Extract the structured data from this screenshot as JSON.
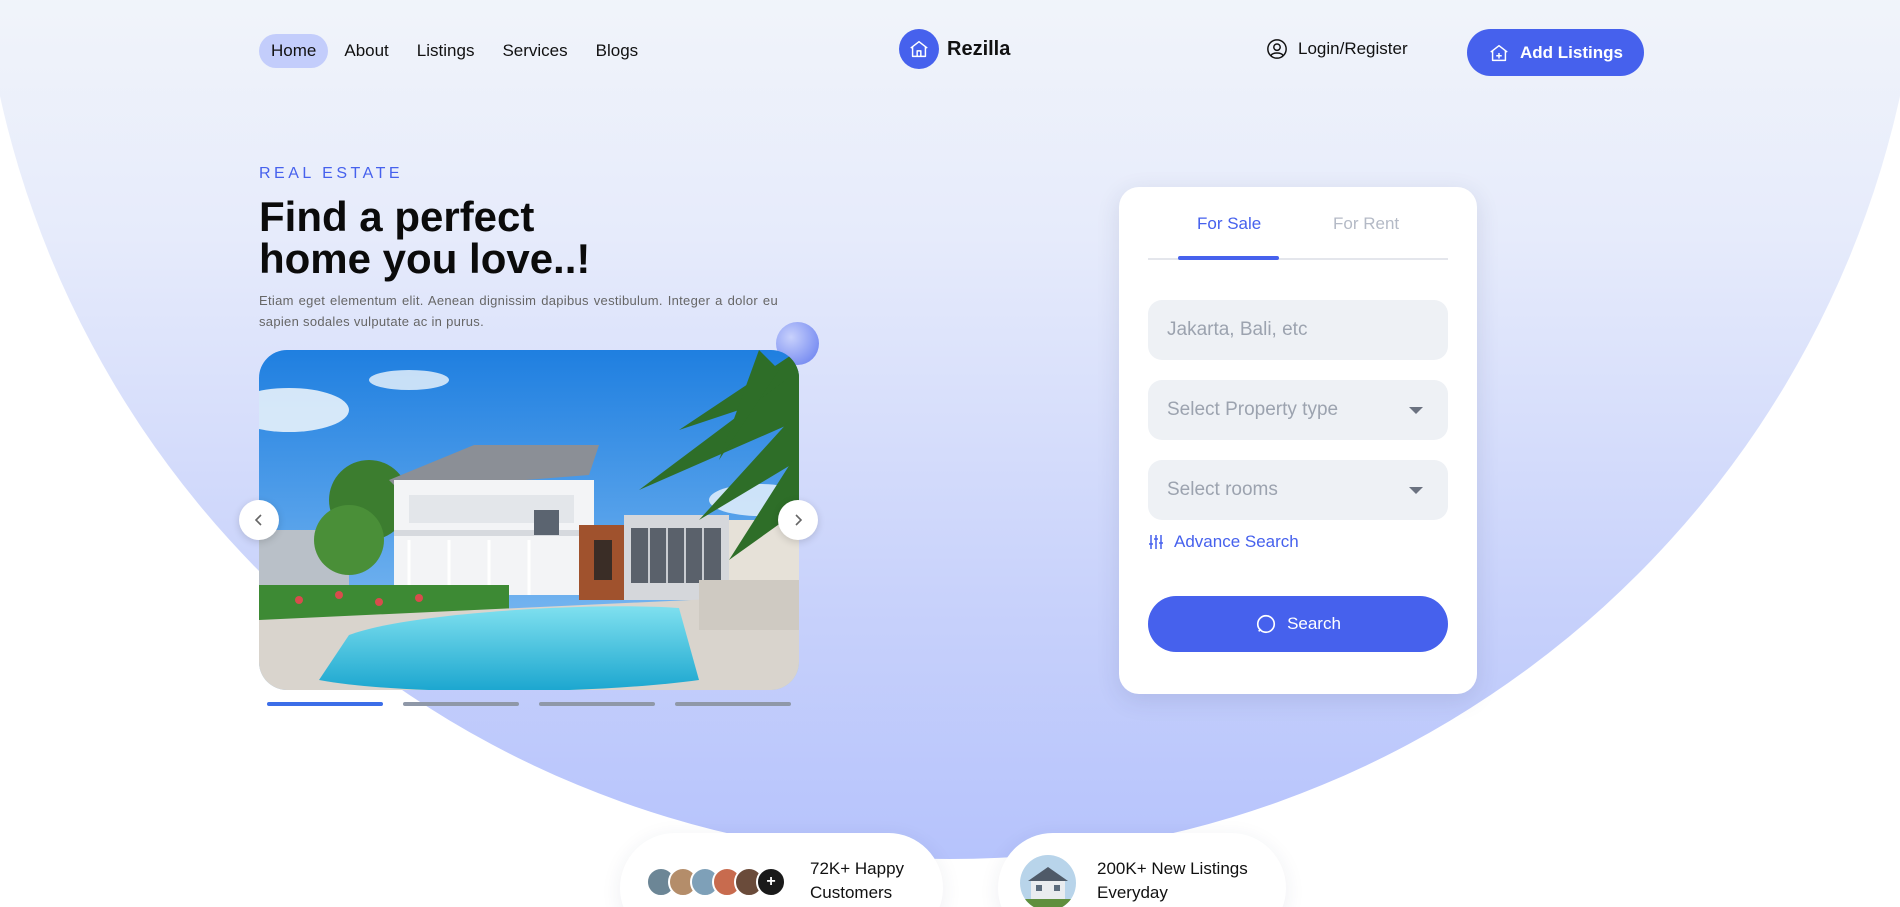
{
  "nav": {
    "links": [
      "Home",
      "About",
      "Listings",
      "Services",
      "Blogs"
    ],
    "brand": "Rezilla",
    "login": "Login/Register",
    "add_listings": "Add Listings"
  },
  "hero": {
    "eyebrow": "REAL ESTATE",
    "headline_line1": "Find a perfect",
    "headline_line2": "home you love..!",
    "description": "Etiam eget elementum elit. Aenean dignissim dapibus vestibulum. Integer a dolor eu sapien sodales vulputate ac in purus."
  },
  "carousel": {
    "slide_count": 4,
    "active_slide": 1
  },
  "search": {
    "tabs": [
      "For Sale",
      "For Rent"
    ],
    "active_tab": "For Sale",
    "location_placeholder": "Jakarta, Bali, etc",
    "property_type": "Select Property type",
    "rooms": "Select rooms",
    "advance_search": "Advance Search",
    "search_button": "Search"
  },
  "stats": {
    "customers": "72K+ Happy Customers",
    "listings": "200K+ New Listings Everyday",
    "plus_icon": "+"
  },
  "colors": {
    "accent": "#4661ed",
    "active_pill": "#c3cdfb",
    "hero_gradient_end": "#b6c3fc"
  }
}
